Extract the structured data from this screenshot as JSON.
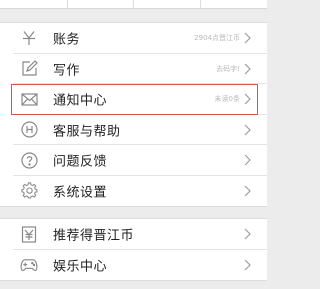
{
  "menu": {
    "items": [
      {
        "label": "账务",
        "value": "2904点晋江币",
        "icon": "currency-yen-icon"
      },
      {
        "label": "写作",
        "value": "去码字!",
        "icon": "edit-icon"
      },
      {
        "label": "通知中心",
        "value": "未读0条",
        "icon": "mail-icon"
      },
      {
        "label": "客服与帮助",
        "value": "",
        "icon": "help-circle-icon"
      },
      {
        "label": "问题反馈",
        "value": "",
        "icon": "question-icon"
      },
      {
        "label": "系统设置",
        "value": "",
        "icon": "gear-icon"
      }
    ]
  },
  "extras": {
    "items": [
      {
        "label": "推荐得晋江币",
        "value": "",
        "icon": "gift-box-icon"
      },
      {
        "label": "娱乐中心",
        "value": "",
        "icon": "gamepad-icon"
      }
    ]
  },
  "colors": {
    "highlight": "#d9534f",
    "icon": "#888888"
  }
}
